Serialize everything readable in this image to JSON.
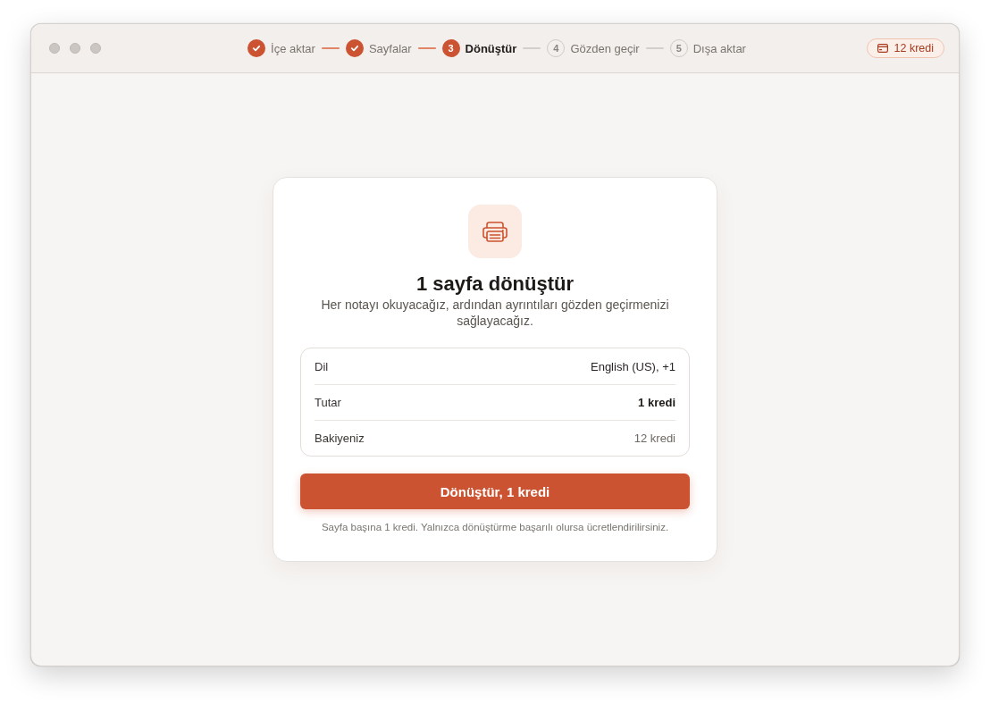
{
  "steps": [
    {
      "label": "İçe aktar",
      "completed": true,
      "selected": false
    },
    {
      "label": "Sayfalar",
      "completed": true,
      "selected": false
    },
    {
      "number": "3",
      "label": "Dönüştür",
      "completed": false,
      "selected": true
    },
    {
      "number": "4",
      "label": "Gözden geçir",
      "completed": false,
      "selected": false
    },
    {
      "number": "5",
      "label": "Dışa aktar",
      "completed": false,
      "selected": false
    }
  ],
  "credit_badge": {
    "label": "12 kredi"
  },
  "card": {
    "title": "1 sayfa dönüştür",
    "subtitle": "Her notayı okuyacağız, ardından ayrıntıları gözden geçirmenizi sağlayacağız.",
    "summary": [
      {
        "label": "Dil",
        "value": "English (US), +1",
        "kind": "normal"
      },
      {
        "label": "Tutar",
        "value": "1 kredi",
        "kind": "strong"
      },
      {
        "label": "Bakiyeniz",
        "value": "12 kredi",
        "kind": "muted"
      }
    ],
    "button": "Dönüştür, 1 kredi",
    "footnote": "Sayfa başına 1 kredi. Yalnızca dönüştürme başarılı olursa ücretlendirilirsiniz."
  }
}
